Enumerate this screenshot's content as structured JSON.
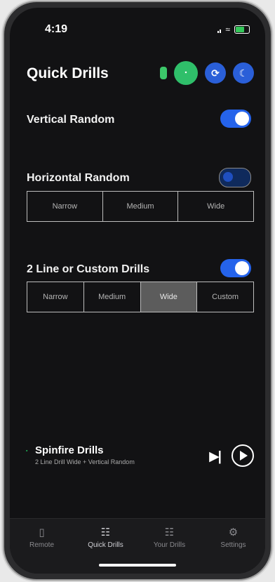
{
  "status_bar": {
    "time": "4:19"
  },
  "header": {
    "title": "Quick Drills",
    "icons": [
      "ball-icon",
      "bluetooth-icon",
      "refresh-icon",
      "moon-icon"
    ]
  },
  "vertical_random": {
    "label": "Vertical Random",
    "enabled": true
  },
  "horizontal_random": {
    "label": "Horizontal Random",
    "enabled": false,
    "options": [
      "Narrow",
      "Medium",
      "Wide"
    ],
    "selected": null
  },
  "two_line": {
    "label": "2 Line or Custom Drills",
    "enabled": true,
    "options": [
      "Narrow",
      "Medium",
      "Wide",
      "Custom"
    ],
    "selected": "Wide"
  },
  "player": {
    "title": "Spinfire Drills",
    "subtitle": "2 Line Drill Wide + Vertical Random"
  },
  "tabs": [
    {
      "label": "Remote",
      "icon": "remote-icon",
      "active": false
    },
    {
      "label": "Quick Drills",
      "icon": "sliders-icon",
      "active": true
    },
    {
      "label": "Your Drills",
      "icon": "sliders-icon",
      "active": false
    },
    {
      "label": "Settings",
      "icon": "gear-icon",
      "active": false
    }
  ],
  "colors": {
    "accent": "#2563eb",
    "connected": "#2fbf6a",
    "background": "#121214"
  }
}
